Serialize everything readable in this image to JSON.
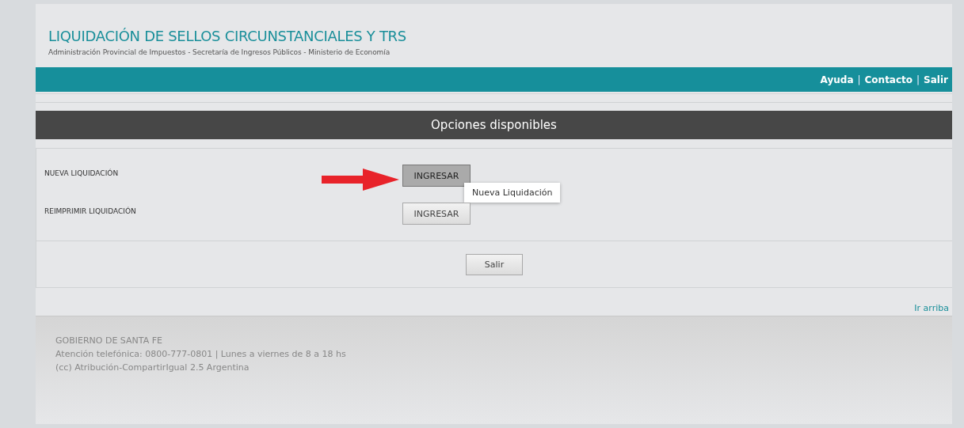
{
  "header": {
    "title": "LIQUIDACIÓN DE SELLOS CIRCUNSTANCIALES Y TRS",
    "subtitle": "Administración Provincial de Impuestos - Secretaría de Ingresos Públicos - Ministerio de Economía"
  },
  "nav": [
    {
      "kind": "link",
      "text": "Ayuda"
    },
    {
      "kind": "separator",
      "text": "|"
    },
    {
      "kind": "link",
      "text": "Contacto"
    },
    {
      "kind": "separator",
      "text": "|"
    },
    {
      "kind": "link",
      "text": "Salir"
    }
  ],
  "panel_title": "Opciones disponibles",
  "options": [
    {
      "label": "NUEVA LIQUIDACIÓN",
      "button": "INGRESAR",
      "hovered": true,
      "arrow": true,
      "tooltip": "Nueva Liquidación"
    },
    {
      "label": "REIMPRIMIR LIQUIDACIÓN",
      "button": "INGRESAR",
      "hovered": false,
      "arrow": false
    }
  ],
  "exit_button": "Salir",
  "top_link": "Ir arriba",
  "footer": [
    "GOBIERNO DE SANTA FE",
    "Atención telefónica: 0800-777-0801 | Lunes a viernes de 8 a 18 hs",
    "(cc) Atribución-CompartirIgual 2.5 Argentina"
  ]
}
